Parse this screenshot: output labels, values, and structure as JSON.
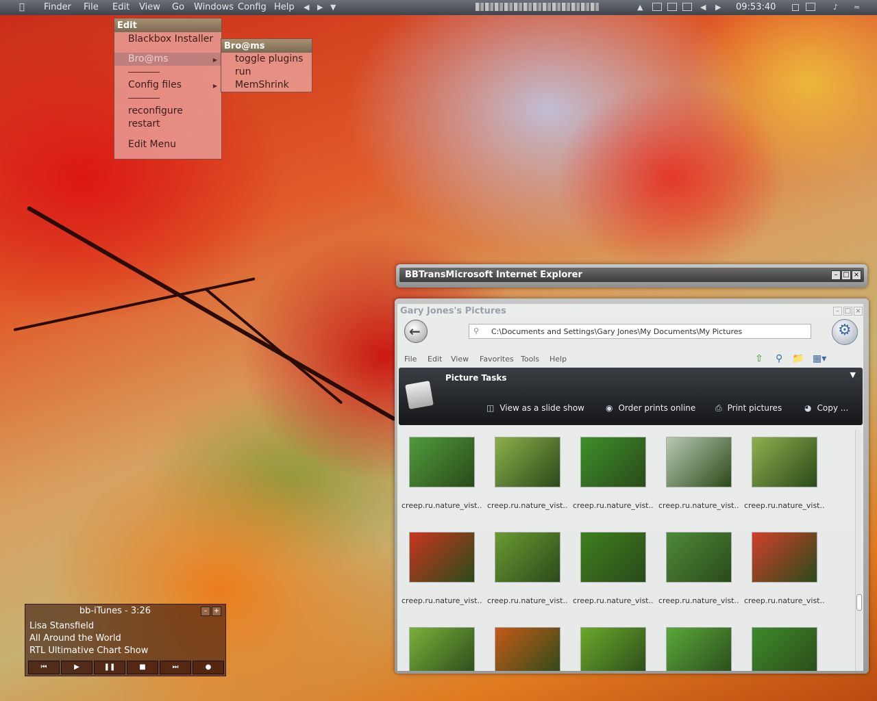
{
  "topbar": {
    "apple_icon": "apple-icon",
    "menus": [
      "Finder",
      "File",
      "Edit",
      "View",
      "Go",
      "Windows",
      "Config",
      "Help"
    ],
    "clock": "09:53:40"
  },
  "edit_menu": {
    "title": "Edit",
    "items": [
      "Blackbox Installer",
      "Bro@ms",
      "Config files",
      "reconfigure",
      "restart",
      "Edit Menu"
    ]
  },
  "broams_menu": {
    "title": "Bro@ms",
    "items": [
      "toggle plugins",
      "run",
      "MemShrink"
    ]
  },
  "ie_window": {
    "title": "BBTransMicrosoft Internet Explorer"
  },
  "explorer": {
    "title": "Gary Jones's Pictures",
    "address": "C:\\Documents and Settings\\Gary Jones\\My Documents\\My Pictures",
    "menu": [
      "File",
      "Edit",
      "View",
      "Favorites",
      "Tools",
      "Help"
    ],
    "picture_tasks": {
      "header": "Picture Tasks",
      "tasks": [
        "View as a slide show",
        "Order prints online",
        "Print pictures",
        "Copy ..."
      ]
    },
    "thumbnails": [
      {
        "caption": "creep.ru.nature_vist...",
        "color": "#4f9a3a"
      },
      {
        "caption": "creep.ru.nature_vist...",
        "color": "#8ab04a"
      },
      {
        "caption": "creep.ru.nature_vist...",
        "color": "#3e8f2a"
      },
      {
        "caption": "creep.ru.nature_vist...",
        "color": "#b9c9b0"
      },
      {
        "caption": "creep.ru.nature_vist...",
        "color": "#8fb04e"
      },
      {
        "caption": "creep.ru.nature_vist...",
        "color": "#c8361e"
      },
      {
        "caption": "creep.ru.nature_vist...",
        "color": "#6a9a32"
      },
      {
        "caption": "creep.ru.nature_vist...",
        "color": "#3f7f1e"
      },
      {
        "caption": "creep.ru.nature_vist...",
        "color": "#4e8a3a"
      },
      {
        "caption": "creep.ru.nature_vist...",
        "color": "#d0402a"
      },
      {
        "caption": "",
        "color": "#7ab03a"
      },
      {
        "caption": "",
        "color": "#c45a18"
      },
      {
        "caption": "",
        "color": "#6aa82a"
      },
      {
        "caption": "",
        "color": "#5aa83a"
      },
      {
        "caption": "",
        "color": "#3e8a2a"
      }
    ]
  },
  "itunes": {
    "title": "bb-iTunes - 3:26",
    "lines": [
      "Lisa Stansfield",
      "All Around the World",
      "RTL Ultimative Chart Show"
    ],
    "controls": [
      "previous-icon",
      "play-icon",
      "pause-icon",
      "stop-icon",
      "next-icon",
      "record-icon"
    ]
  }
}
